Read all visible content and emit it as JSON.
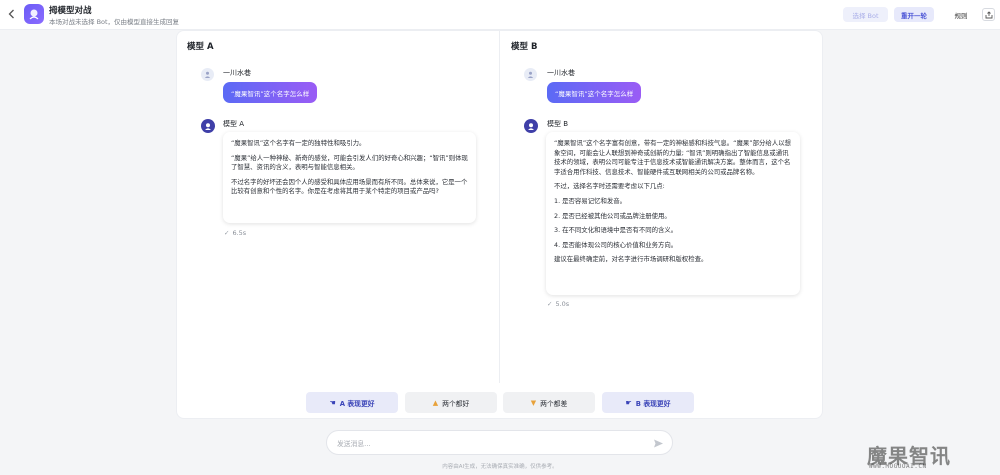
{
  "header": {
    "title": "拇模型对战",
    "subtitle": "本场对战未选择 Bot，仅由模型直接生成回复",
    "select_bot_label": "选择 Bot",
    "restart_label": "重开一轮",
    "rules_label": "规则"
  },
  "panels": [
    {
      "title": "模型 A",
      "user_name": "一川水巷",
      "user_message": "“魔果智讯”这个名字怎么样",
      "bot_name": "模型 A",
      "response": [
        "“魔果智讯”这个名字有一定的独特性和吸引力。",
        "“魔果”给人一种神秘、新奇的感觉，可能会引发人们的好奇心和兴趣；“智讯”则体现了智慧、资讯的含义，表明与智能信息相关。",
        "不过名字的好坏还会因个人的感受和具体应用场景而有所不同。总体来说，它是一个比较有创意和个性的名字。你是在考虑将其用于某个特定的项目或产品吗?"
      ],
      "timing": "6.5s"
    },
    {
      "title": "模型 B",
      "user_name": "一川水巷",
      "user_message": "“魔果智讯”这个名字怎么样",
      "bot_name": "模型 B",
      "response_intro": [
        "“魔果智讯”这个名字富有创意，带有一定的神秘感和科技气息。“魔果”部分给人以想象空间，可能会让人联想到神奇或创新的力量; “智讯”则明确指出了智能信息或通讯技术的领域，表明公司可能专注于信息技术或智能通讯解决方案。整体而言，这个名字适合用作科技、信息技术、智能硬件或互联网相关的公司或品牌名称。",
        "不过，选择名字时还需要考虑以下几点:"
      ],
      "response_list": [
        "1. 是否容易记忆和发音。",
        "2. 是否已经被其他公司或品牌注册使用。",
        "3. 在不同文化和语境中是否有不同的含义。",
        "4. 是否能体现公司的核心价值和业务方向。"
      ],
      "response_outro": "建议在最终确定前，对名字进行市场调研和版权检查。",
      "timing": "5.0s"
    }
  ],
  "votes": {
    "a_better": "A 表现更好",
    "both_good": "两个都好",
    "both_bad": "两个都差",
    "b_better": "B 表现更好"
  },
  "input": {
    "placeholder": "发送消息..."
  },
  "disclaimer": "内容由AI生成，无法确保真实准确，仅供参考。",
  "watermark": {
    "text": "魔果智讯",
    "url": "WWW.MOGUOAI.CN"
  },
  "colors": {
    "accent": "#4c55d6",
    "bubble_gradient_start": "#5b6af5",
    "bubble_gradient_end": "#9a5cf5"
  }
}
